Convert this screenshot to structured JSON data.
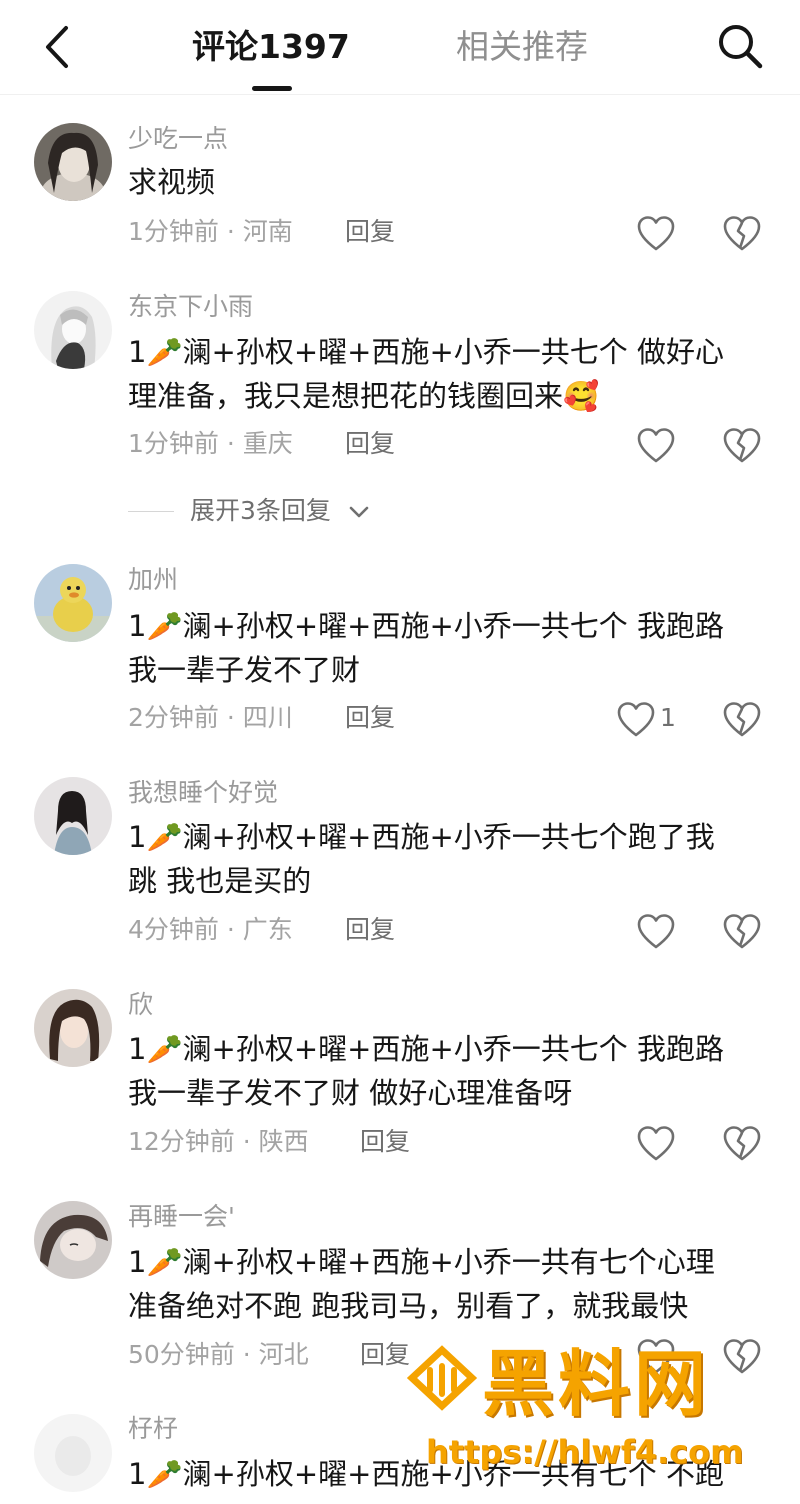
{
  "header": {
    "back_icon": "chevron-left-icon",
    "active_tab": "评论1397",
    "inactive_tab": "相关推荐",
    "search_icon": "search-icon"
  },
  "comments": [
    {
      "name": "少吃一点",
      "text": "求视频",
      "time": "1分钟前 · 河南",
      "reply": "回复",
      "likes": ""
    },
    {
      "name": "东京下小雨",
      "text": "1🥕澜+孙权+曜+西施+小乔一共七个 做好心\n理准备，我只是想把花的钱圈回来🥰",
      "time": "1分钟前 · 重庆",
      "reply": "回复",
      "likes": ""
    },
    {
      "name": "加州",
      "text": "1🥕澜+孙权+曜+西施+小乔一共七个 我跑路\n我一辈子发不了财",
      "time": "2分钟前 · 四川",
      "reply": "回复",
      "likes": "1"
    },
    {
      "name": "我想睡个好觉",
      "text": "1🥕澜+孙权+曜+西施+小乔一共七个跑了我\n跳 我也是买的",
      "time": "4分钟前 · 广东",
      "reply": "回复",
      "likes": ""
    },
    {
      "name": "欣",
      "text": "1🥕澜+孙权+曜+西施+小乔一共七个 我跑路\n我一辈子发不了财 做好心理准备呀",
      "time": "12分钟前 · 陕西",
      "reply": "回复",
      "likes": ""
    },
    {
      "name": "再睡一会'",
      "text": "1🥕澜+孙权+曜+西施+小乔一共有七个心理\n准备绝对不跑 跑我司马，别看了，就我最快",
      "time": "50分钟前 · 河北",
      "reply": "回复",
      "likes": ""
    },
    {
      "name": "杍杍",
      "text": "1🥕澜+孙权+曜+西施+小乔一共有七个 不跑",
      "time": "",
      "reply": "",
      "likes": ""
    }
  ],
  "expand_replies": "展开3条回复",
  "watermark": {
    "title": "黑料网",
    "url": "https://hlwf4.com",
    "color": "#f5a300"
  },
  "colors": {
    "text": "#161616",
    "secondary": "#9a9a9a",
    "icon": "#6f6f6f"
  }
}
